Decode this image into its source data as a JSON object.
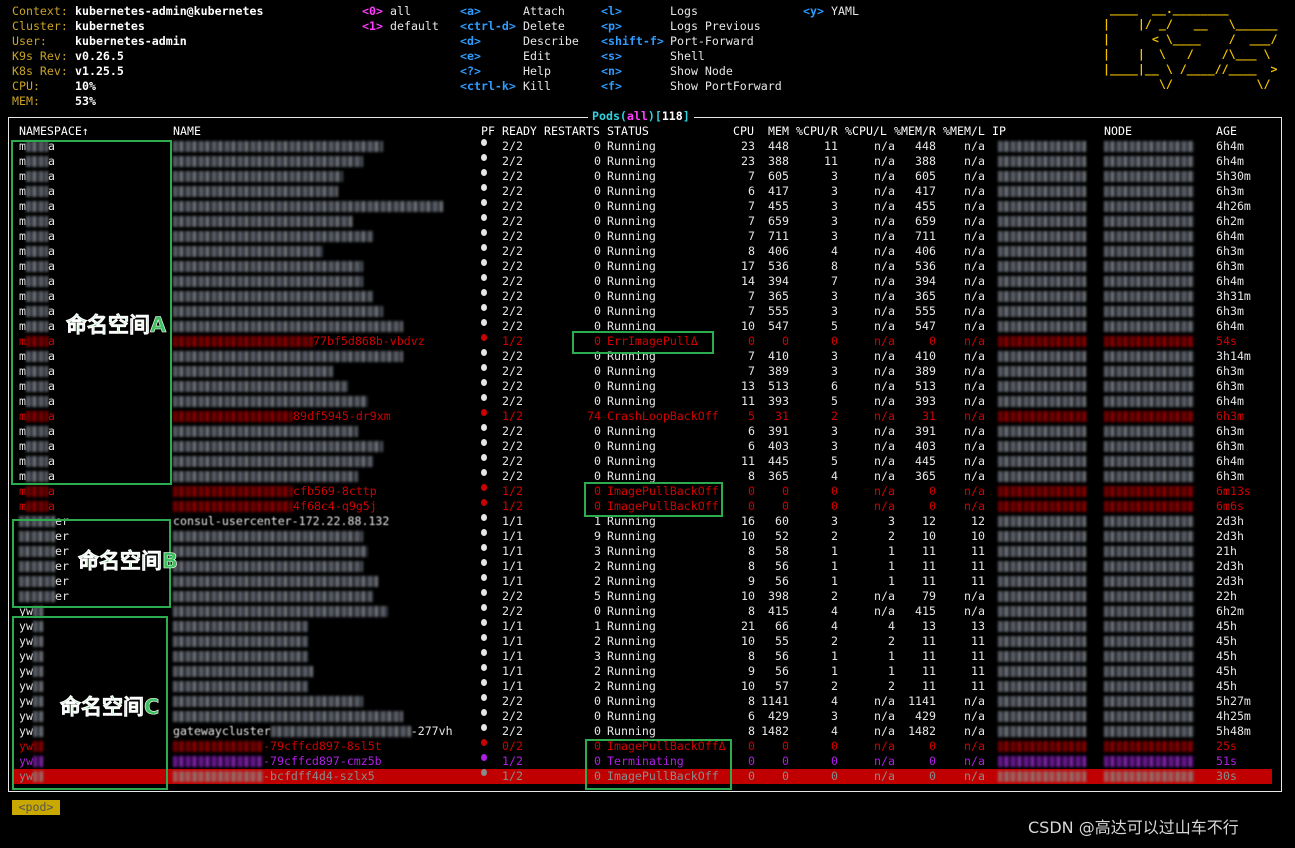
{
  "header": {
    "info": [
      {
        "label": "Context:",
        "value": "kubernetes-admin@kubernetes"
      },
      {
        "label": "Cluster:",
        "value": "kubernetes"
      },
      {
        "label": "User:",
        "value": "kubernetes-admin"
      },
      {
        "label": "K9s Rev:",
        "value": "v0.26.5"
      },
      {
        "label": "K8s Rev:",
        "value": "v1.25.5"
      },
      {
        "label": "CPU:",
        "value": "10%"
      },
      {
        "label": "MEM:",
        "value": "53%"
      }
    ],
    "namespaces": [
      {
        "key": "<0>",
        "label": "all"
      },
      {
        "key": "<1>",
        "label": "default"
      }
    ],
    "hotkeys_col1": [
      {
        "key": "<a>",
        "label": "Attach"
      },
      {
        "key": "<ctrl-d>",
        "label": "Delete"
      },
      {
        "key": "<d>",
        "label": "Describe"
      },
      {
        "key": "<e>",
        "label": "Edit"
      },
      {
        "key": "<?>",
        "label": "Help"
      },
      {
        "key": "<ctrl-k>",
        "label": "Kill"
      }
    ],
    "hotkeys_col2": [
      {
        "key": "<l>",
        "label": "Logs"
      },
      {
        "key": "<p>",
        "label": "Logs Previous"
      },
      {
        "key": "<shift-f>",
        "label": "Port-Forward"
      },
      {
        "key": "<s>",
        "label": "Shell"
      },
      {
        "key": "<n>",
        "label": "Show Node"
      },
      {
        "key": "<f>",
        "label": "Show PortForward"
      }
    ],
    "hotkeys_col3": [
      {
        "key": "<y>",
        "label": "YAML"
      }
    ],
    "logo": " ____  __.________       \n|    |/ _/   __   \\______\n|      < \\____    /  ___/\n|    |  \\   /    /\\___ \\ \n|____|__ \\ /____//____  >\n        \\/            \\/ "
  },
  "table": {
    "title": {
      "resource": "Pods",
      "namespace": "all",
      "count": "118"
    },
    "columns": [
      "NAMESPACE↑",
      "NAME",
      "PF",
      "READY",
      "RESTARTS",
      "STATUS",
      "CPU",
      "MEM",
      "%CPU/R",
      "%CPU/L",
      "%MEM/R",
      "%MEM/L",
      "IP",
      "NODE",
      "AGE"
    ],
    "rows": [
      [
        "m",
        "a",
        "",
        "",
        "2/2",
        "0",
        "Running",
        "23",
        "448",
        "11",
        "n/a",
        "448",
        "n/a",
        "6h4m",
        "ok"
      ],
      [
        "m",
        "a",
        "",
        "",
        "2/2",
        "0",
        "Running",
        "23",
        "388",
        "11",
        "n/a",
        "388",
        "n/a",
        "6h4m",
        "ok"
      ],
      [
        "m",
        "a",
        "",
        "",
        "2/2",
        "0",
        "Running",
        "7",
        "605",
        "3",
        "n/a",
        "605",
        "n/a",
        "5h30m",
        "ok"
      ],
      [
        "m",
        "a",
        "",
        "",
        "2/2",
        "0",
        "Running",
        "6",
        "417",
        "3",
        "n/a",
        "417",
        "n/a",
        "6h3m",
        "ok"
      ],
      [
        "m",
        "a",
        "",
        "",
        "2/2",
        "0",
        "Running",
        "7",
        "455",
        "3",
        "n/a",
        "455",
        "n/a",
        "4h26m",
        "ok"
      ],
      [
        "m",
        "a",
        "",
        "",
        "2/2",
        "0",
        "Running",
        "7",
        "659",
        "3",
        "n/a",
        "659",
        "n/a",
        "6h2m",
        "ok"
      ],
      [
        "m",
        "a",
        "",
        "",
        "2/2",
        "0",
        "Running",
        "7",
        "711",
        "3",
        "n/a",
        "711",
        "n/a",
        "6h4m",
        "ok"
      ],
      [
        "m",
        "a",
        "",
        "",
        "2/2",
        "0",
        "Running",
        "8",
        "406",
        "4",
        "n/a",
        "406",
        "n/a",
        "6h3m",
        "ok"
      ],
      [
        "m",
        "a",
        "",
        "",
        "2/2",
        "0",
        "Running",
        "17",
        "536",
        "8",
        "n/a",
        "536",
        "n/a",
        "6h3m",
        "ok"
      ],
      [
        "m",
        "a",
        "",
        "",
        "2/2",
        "0",
        "Running",
        "14",
        "394",
        "7",
        "n/a",
        "394",
        "n/a",
        "6h4m",
        "ok"
      ],
      [
        "m",
        "a",
        "",
        "",
        "2/2",
        "0",
        "Running",
        "7",
        "365",
        "3",
        "n/a",
        "365",
        "n/a",
        "3h31m",
        "ok"
      ],
      [
        "m",
        "a",
        "",
        "",
        "2/2",
        "0",
        "Running",
        "7",
        "555",
        "3",
        "n/a",
        "555",
        "n/a",
        "6h3m",
        "ok"
      ],
      [
        "m",
        "a",
        "",
        "",
        "2/2",
        "0",
        "Running",
        "10",
        "547",
        "5",
        "n/a",
        "547",
        "n/a",
        "6h4m",
        "ok"
      ],
      [
        "m",
        "a",
        "",
        "77bf5d868b-vbdvz",
        "1/2",
        "0",
        "ErrImagePullΔ",
        "0",
        "0",
        "0",
        "n/a",
        "0",
        "n/a",
        "54s",
        "err"
      ],
      [
        "m",
        "a",
        "",
        "",
        "2/2",
        "0",
        "Running",
        "7",
        "410",
        "3",
        "n/a",
        "410",
        "n/a",
        "3h14m",
        "ok"
      ],
      [
        "m",
        "a",
        "",
        "",
        "2/2",
        "0",
        "Running",
        "7",
        "389",
        "3",
        "n/a",
        "389",
        "n/a",
        "6h3m",
        "ok"
      ],
      [
        "m",
        "a",
        "",
        "",
        "2/2",
        "0",
        "Running",
        "13",
        "513",
        "6",
        "n/a",
        "513",
        "n/a",
        "6h3m",
        "ok"
      ],
      [
        "m",
        "a",
        "",
        "",
        "2/2",
        "0",
        "Running",
        "11",
        "393",
        "5",
        "n/a",
        "393",
        "n/a",
        "6h4m",
        "ok"
      ],
      [
        "m",
        "a",
        "",
        "89df5945-dr9xm",
        "1/2",
        "74",
        "CrashLoopBackOff",
        "5",
        "31",
        "2",
        "n/a",
        "31",
        "n/a",
        "6h3m",
        "err"
      ],
      [
        "m",
        "a",
        "",
        "",
        "2/2",
        "0",
        "Running",
        "6",
        "391",
        "3",
        "n/a",
        "391",
        "n/a",
        "6h3m",
        "ok"
      ],
      [
        "m",
        "a",
        "",
        "",
        "2/2",
        "0",
        "Running",
        "6",
        "403",
        "3",
        "n/a",
        "403",
        "n/a",
        "6h3m",
        "ok"
      ],
      [
        "m",
        "a",
        "",
        "",
        "2/2",
        "0",
        "Running",
        "11",
        "445",
        "5",
        "n/a",
        "445",
        "n/a",
        "6h4m",
        "ok"
      ],
      [
        "m",
        "a",
        "",
        "",
        "2/2",
        "0",
        "Running",
        "8",
        "365",
        "4",
        "n/a",
        "365",
        "n/a",
        "6h3m",
        "ok"
      ],
      [
        "m",
        "a",
        "",
        "cfb569-8cttp",
        "1/2",
        "0",
        "ImagePullBackOff",
        "0",
        "0",
        "0",
        "n/a",
        "0",
        "n/a",
        "6m13s",
        "err"
      ],
      [
        "m",
        "a",
        "",
        "4f68c4-q9g5j",
        "1/2",
        "0",
        "ImagePullBackOff",
        "0",
        "0",
        "0",
        "n/a",
        "0",
        "n/a",
        "6m6s",
        "err"
      ],
      [
        "",
        "er",
        "consul-usercenter-172.22.88.132",
        "",
        "1/1",
        "1",
        "Running",
        "16",
        "60",
        "3",
        "3",
        "12",
        "12",
        "2d3h",
        "ok"
      ],
      [
        "",
        "er",
        "",
        "",
        "1/1",
        "9",
        "Running",
        "10",
        "52",
        "2",
        "2",
        "10",
        "10",
        "2d3h",
        "ok"
      ],
      [
        "",
        "er",
        "",
        "",
        "1/1",
        "3",
        "Running",
        "8",
        "58",
        "1",
        "1",
        "11",
        "11",
        "21h",
        "ok"
      ],
      [
        "",
        "er",
        "",
        "",
        "1/1",
        "2",
        "Running",
        "8",
        "56",
        "1",
        "1",
        "11",
        "11",
        "2d3h",
        "ok"
      ],
      [
        "",
        "er",
        "",
        "",
        "1/1",
        "2",
        "Running",
        "9",
        "56",
        "1",
        "1",
        "11",
        "11",
        "2d3h",
        "ok"
      ],
      [
        "",
        "er",
        "",
        "",
        "2/2",
        "5",
        "Running",
        "10",
        "398",
        "2",
        "n/a",
        "79",
        "n/a",
        "22h",
        "ok"
      ],
      [
        "yw",
        "",
        "",
        "",
        "2/2",
        "0",
        "Running",
        "8",
        "415",
        "4",
        "n/a",
        "415",
        "n/a",
        "6h2m",
        "ok"
      ],
      [
        "yw",
        "",
        "",
        "",
        "1/1",
        "1",
        "Running",
        "21",
        "66",
        "4",
        "4",
        "13",
        "13",
        "45h",
        "ok"
      ],
      [
        "yw",
        "",
        "",
        "",
        "1/1",
        "2",
        "Running",
        "10",
        "55",
        "2",
        "2",
        "11",
        "11",
        "45h",
        "ok"
      ],
      [
        "yw",
        "",
        "",
        "",
        "1/1",
        "3",
        "Running",
        "8",
        "56",
        "1",
        "1",
        "11",
        "11",
        "45h",
        "ok"
      ],
      [
        "yw",
        "",
        "",
        "",
        "1/1",
        "2",
        "Running",
        "9",
        "56",
        "1",
        "1",
        "11",
        "11",
        "45h",
        "ok"
      ],
      [
        "yw",
        "",
        "",
        "",
        "1/1",
        "2",
        "Running",
        "10",
        "57",
        "2",
        "2",
        "11",
        "11",
        "45h",
        "ok"
      ],
      [
        "yw",
        "",
        "",
        "",
        "2/2",
        "0",
        "Running",
        "8",
        "1141",
        "4",
        "n/a",
        "1141",
        "n/a",
        "5h27m",
        "ok"
      ],
      [
        "yw",
        "",
        "",
        "",
        "2/2",
        "0",
        "Running",
        "6",
        "429",
        "3",
        "n/a",
        "429",
        "n/a",
        "4h25m",
        "ok"
      ],
      [
        "yw",
        "",
        "gatewaycluster",
        "-277vh",
        "2/2",
        "0",
        "Running",
        "8",
        "1482",
        "4",
        "n/a",
        "1482",
        "n/a",
        "5h48m",
        "ok"
      ],
      [
        "yw",
        "",
        "",
        "-79cffcd897-8sl5t",
        "0/2",
        "0",
        "ImagePullBackOffΔ",
        "0",
        "0",
        "0",
        "n/a",
        "0",
        "n/a",
        "25s",
        "err"
      ],
      [
        "yw",
        "",
        "",
        "-79cffcd897-cmz5b",
        "1/2",
        "0",
        "Terminating",
        "0",
        "0",
        "0",
        "n/a",
        "0",
        "n/a",
        "51s",
        "term"
      ],
      [
        "yw",
        "",
        "",
        "-bcfdff4d4-szlx5",
        "1/2",
        "0",
        "ImagePullBackOff",
        "0",
        "0",
        "0",
        "n/a",
        "0",
        "n/a",
        "30s",
        "selected"
      ]
    ]
  },
  "annotations": {
    "ns_a": "命名空间A",
    "ns_b": "命名空间B",
    "ns_c": "命名空间C"
  },
  "footer": {
    "crumb": "<pod>"
  },
  "watermark": "CSDN @高达可以过山车不行",
  "colors": {
    "error": "#d10000",
    "terminating": "#b01fe8",
    "selected_bg": "#c00000",
    "annotation": "#2dab4f",
    "logo": "#f2c200"
  }
}
